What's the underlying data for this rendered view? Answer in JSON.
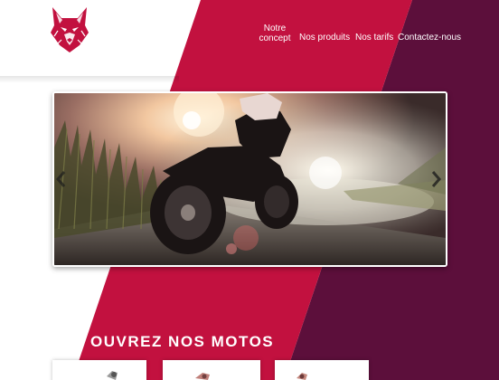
{
  "nav": {
    "items": [
      {
        "label": "Notre concept"
      },
      {
        "label": "Nos produits"
      },
      {
        "label": "Nos tarifs"
      },
      {
        "label": "Contactez-nous"
      }
    ]
  },
  "slider": {
    "prev_icon": "chevron-left-icon",
    "next_icon": "chevron-right-icon",
    "image": "motorcycle-photo"
  },
  "section": {
    "title": "OUVREZ NOS MOTOS"
  },
  "products": {
    "cards": [
      {
        "image": "motorcycle-thumbnail"
      },
      {
        "image": "motorcycle-thumbnail"
      },
      {
        "image": "motorcycle-thumbnail"
      }
    ]
  },
  "colors": {
    "crimson": "#c2113f",
    "plum": "#5c0f3b",
    "white": "#ffffff"
  },
  "logo": {
    "icon": "wolf-head-icon"
  }
}
